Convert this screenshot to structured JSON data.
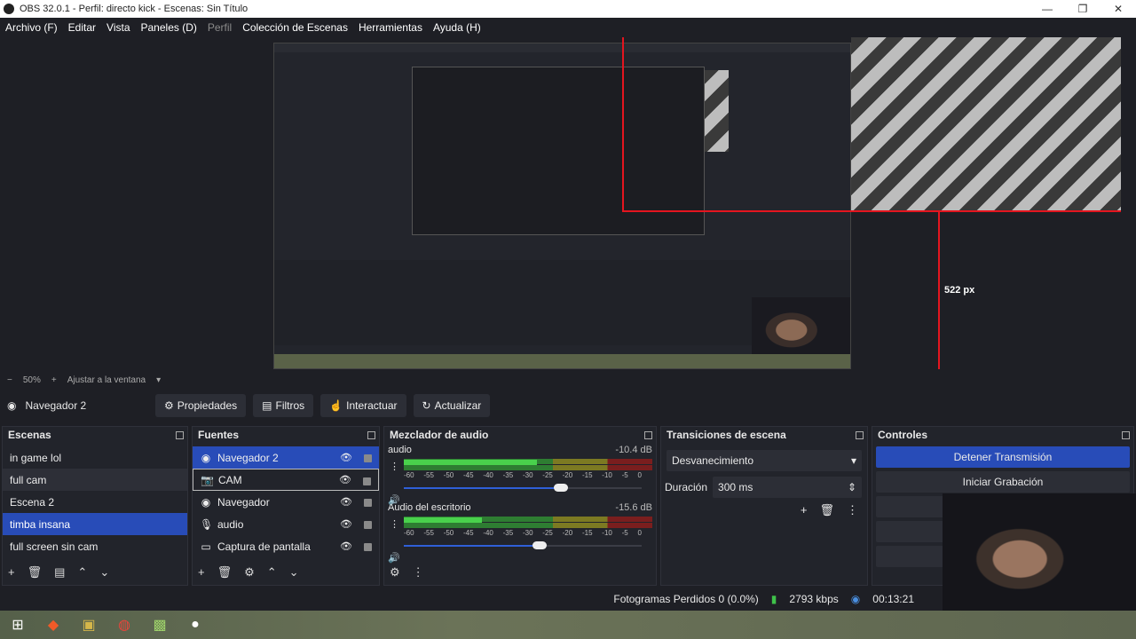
{
  "window": {
    "title": "OBS 32.0.1 - Perfil: directo kick - Escenas: Sin Título"
  },
  "menu": [
    "Archivo (F)",
    "Editar",
    "Vista",
    "Paneles (D)",
    "Perfil",
    "Colección de Escenas",
    "Herramientas",
    "Ayuda (H)"
  ],
  "preview": {
    "label_522": "522 px"
  },
  "zoom": {
    "minus": "−",
    "value": "50%",
    "plus": "+",
    "fit": "Ajustar a la ventana"
  },
  "toolbar": {
    "source": "Navegador 2",
    "props": "Propiedades",
    "filters": "Filtros",
    "interact": "Interactuar",
    "refresh": "Actualizar"
  },
  "scenes": {
    "title": "Escenas",
    "items": [
      "in game lol",
      "full cam",
      "Escena 2",
      "timba insana",
      "full screen sin cam"
    ],
    "selected": "timba insana"
  },
  "sources": {
    "title": "Fuentes",
    "items": [
      "Navegador 2",
      "CAM",
      "Navegador",
      "audio",
      "Captura de pantalla"
    ]
  },
  "mixer": {
    "title": "Mezclador de audio",
    "channels": [
      {
        "name": "audio",
        "db": "-10.4 dB",
        "level": 0.56,
        "volume": 0.66
      },
      {
        "name": "Audio del escritorio",
        "db": "-15.6 dB",
        "level": 0.33,
        "volume": 0.57
      }
    ],
    "scale": [
      "-60",
      "-55",
      "-50",
      "-45",
      "-40",
      "-35",
      "-30",
      "-25",
      "-20",
      "-15",
      "-10",
      "-5",
      "0"
    ]
  },
  "transitions": {
    "title": "Transiciones de escena",
    "selected": "Desvanecimiento",
    "duration_label": "Duración",
    "duration_value": "300 ms"
  },
  "controls": {
    "title": "Controles",
    "stop_stream": "Detener Transmisión",
    "start_rec": "Iniciar Grabación"
  },
  "status": {
    "dropped": "Fotogramas Perdidos 0 (0.0%)",
    "bitrate": "2793 kbps",
    "time": "00:13:21"
  }
}
